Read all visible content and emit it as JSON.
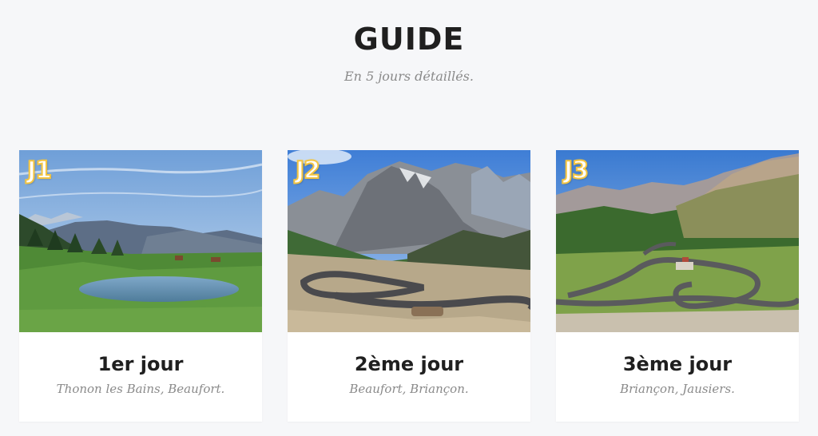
{
  "header": {
    "title": "GUIDE",
    "subtitle": "En 5 jours détaillés."
  },
  "cards": [
    {
      "badge": "J1",
      "title": "1er jour",
      "subtitle": "Thonon les Bains, Beaufort.",
      "image": "alpine-lake-landscape"
    },
    {
      "badge": "J2",
      "title": "2ème jour",
      "subtitle": "Beaufort, Briançon.",
      "image": "mountain-pass-switchbacks"
    },
    {
      "badge": "J3",
      "title": "3ème jour",
      "subtitle": "Briançon, Jausiers.",
      "image": "winding-col-road"
    }
  ]
}
